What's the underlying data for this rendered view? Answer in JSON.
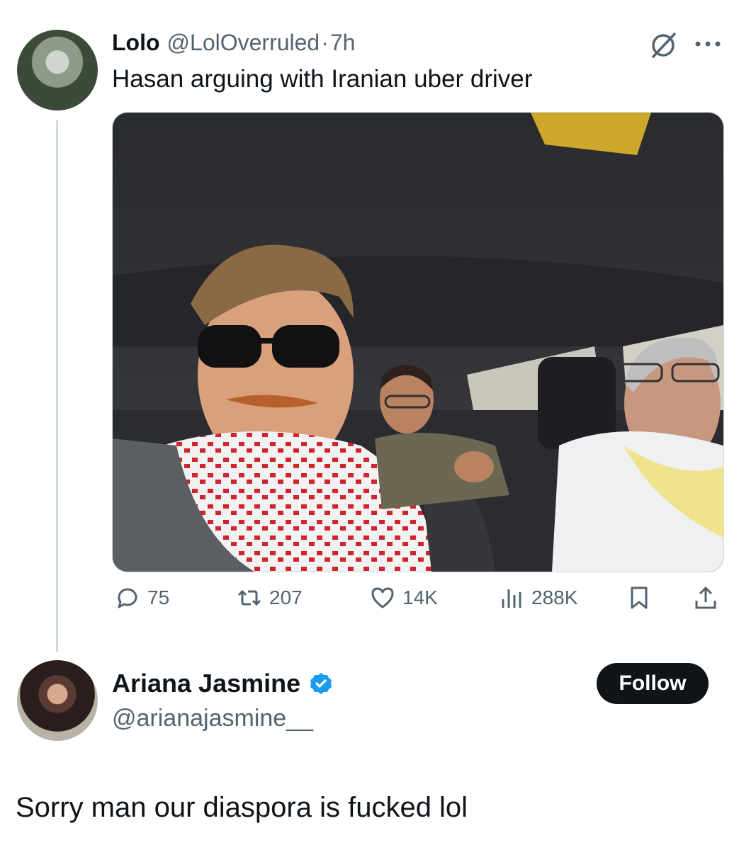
{
  "tweet1": {
    "author_name": "Lolo",
    "author_handle": "@LolOverruled",
    "separator": "·",
    "time": "7h",
    "text": "Hasan arguing with Iranian uber driver",
    "media": {
      "icon": "car-selfie-photo"
    },
    "stats": {
      "replies": "75",
      "reposts": "207",
      "likes": "14K",
      "views": "288K"
    }
  },
  "tweet2": {
    "author_name": "Ariana Jasmine",
    "author_handle": "@arianajasmine__",
    "verified": true,
    "follow_label": "Follow",
    "text": "Sorry man our diaspora is fucked lol"
  },
  "colors": {
    "muted": "#536471",
    "verified": "#1d9bf0",
    "follow_bg": "#0f1419",
    "thread_line": "#cfd9de"
  }
}
